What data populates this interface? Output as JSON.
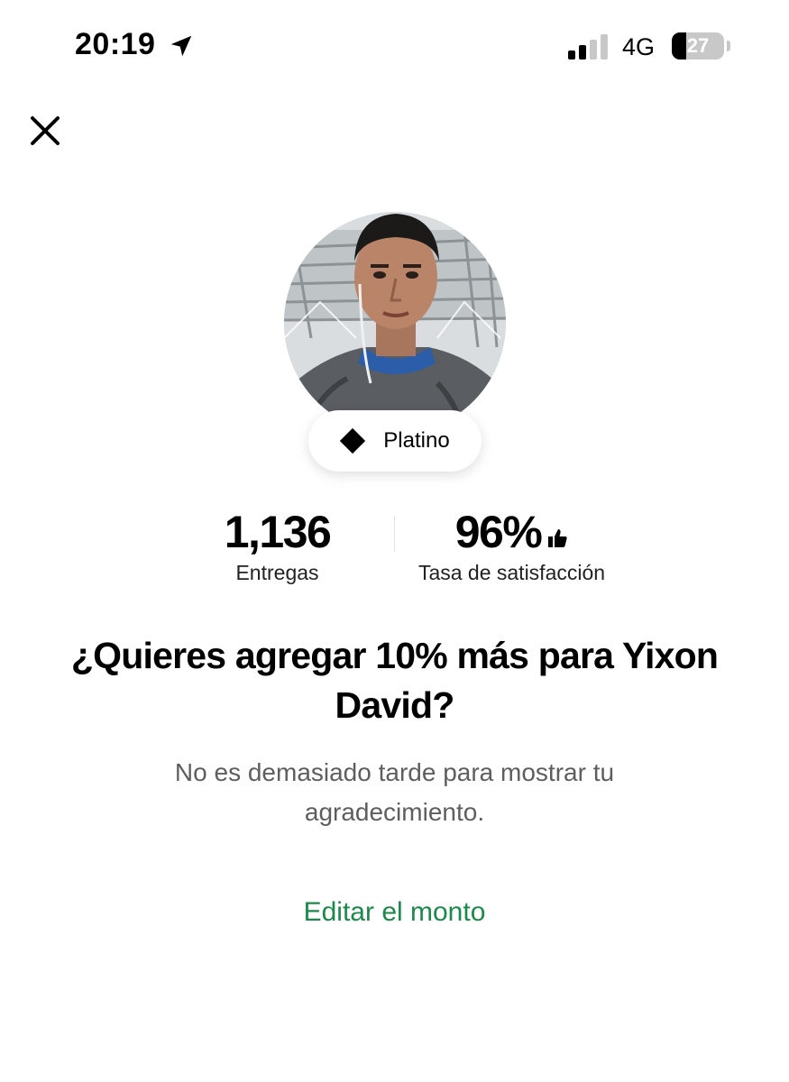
{
  "status_bar": {
    "time": "20:19",
    "network": "4G",
    "battery_percent": "27",
    "battery_level": 0.27,
    "icons": [
      "location-arrow-icon",
      "signal-icon",
      "battery-icon"
    ]
  },
  "header": {
    "close_icon": "close-icon"
  },
  "driver": {
    "tier": "Platino",
    "tier_icon": "diamond-icon"
  },
  "stats": {
    "deliveries_value": "1,136",
    "deliveries_label": "Entregas",
    "satisfaction_value": "96%",
    "satisfaction_label": "Tasa de satisfacción",
    "satisfaction_icon": "thumbs-up-icon"
  },
  "prompt": {
    "title": "¿Quieres agregar 10% más para Yixon David?",
    "subtitle": "No es demasiado tarde para mostrar tu agradecimiento."
  },
  "actions": {
    "edit_label": "Editar el monto"
  },
  "colors": {
    "accent_green": "#1a8a4a",
    "text_gray": "#5e5e5e"
  }
}
